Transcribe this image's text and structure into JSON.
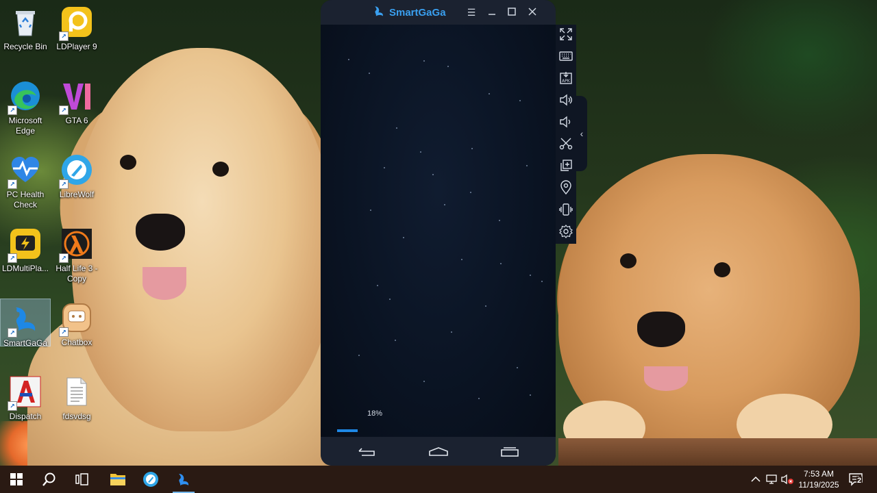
{
  "desktop": {
    "icons": [
      {
        "label": "Recycle Bin",
        "icon": "recycle-bin-icon"
      },
      {
        "label": "LDPlayer 9",
        "icon": "ldplayer-icon"
      },
      {
        "label": "Microsoft Edge",
        "icon": "edge-icon"
      },
      {
        "label": "GTA 6",
        "icon": "gta6-icon"
      },
      {
        "label": "PC Health Check",
        "icon": "pc-health-check-icon"
      },
      {
        "label": "LibreWolf",
        "icon": "librewolf-icon"
      },
      {
        "label": "LDMultiPla...",
        "icon": "ldmultiplayer-icon"
      },
      {
        "label": "Half Life 3 - Copy",
        "icon": "half-life-icon"
      },
      {
        "label": "SmartGaGa",
        "icon": "smartgaga-icon"
      },
      {
        "label": "Chatbox",
        "icon": "chatbox-icon"
      },
      {
        "label": "Dispatch",
        "icon": "dispatch-icon"
      },
      {
        "label": "fdsvdsg",
        "icon": "text-file-icon"
      }
    ]
  },
  "emulator": {
    "title": "SmartGaGa",
    "loading_percent_label": "18%",
    "loading_progress": 0.18,
    "accent": "#1e88e5",
    "sidebar_tools": [
      "fullscreen-icon",
      "keyboard-icon",
      "apk-install-icon",
      "volume-up-icon",
      "volume-down-icon",
      "screenshot-scissors-icon",
      "multi-instance-icon",
      "location-icon",
      "shake-icon",
      "settings-gear-icon"
    ]
  },
  "taskbar": {
    "items": [
      "windows-start-icon",
      "search-icon",
      "task-view-icon",
      "file-explorer-icon",
      "librewolf-icon",
      "smartgaga-icon"
    ],
    "clock_time": "7:53 AM",
    "clock_date": "11/19/2025",
    "notification_count": "2"
  }
}
